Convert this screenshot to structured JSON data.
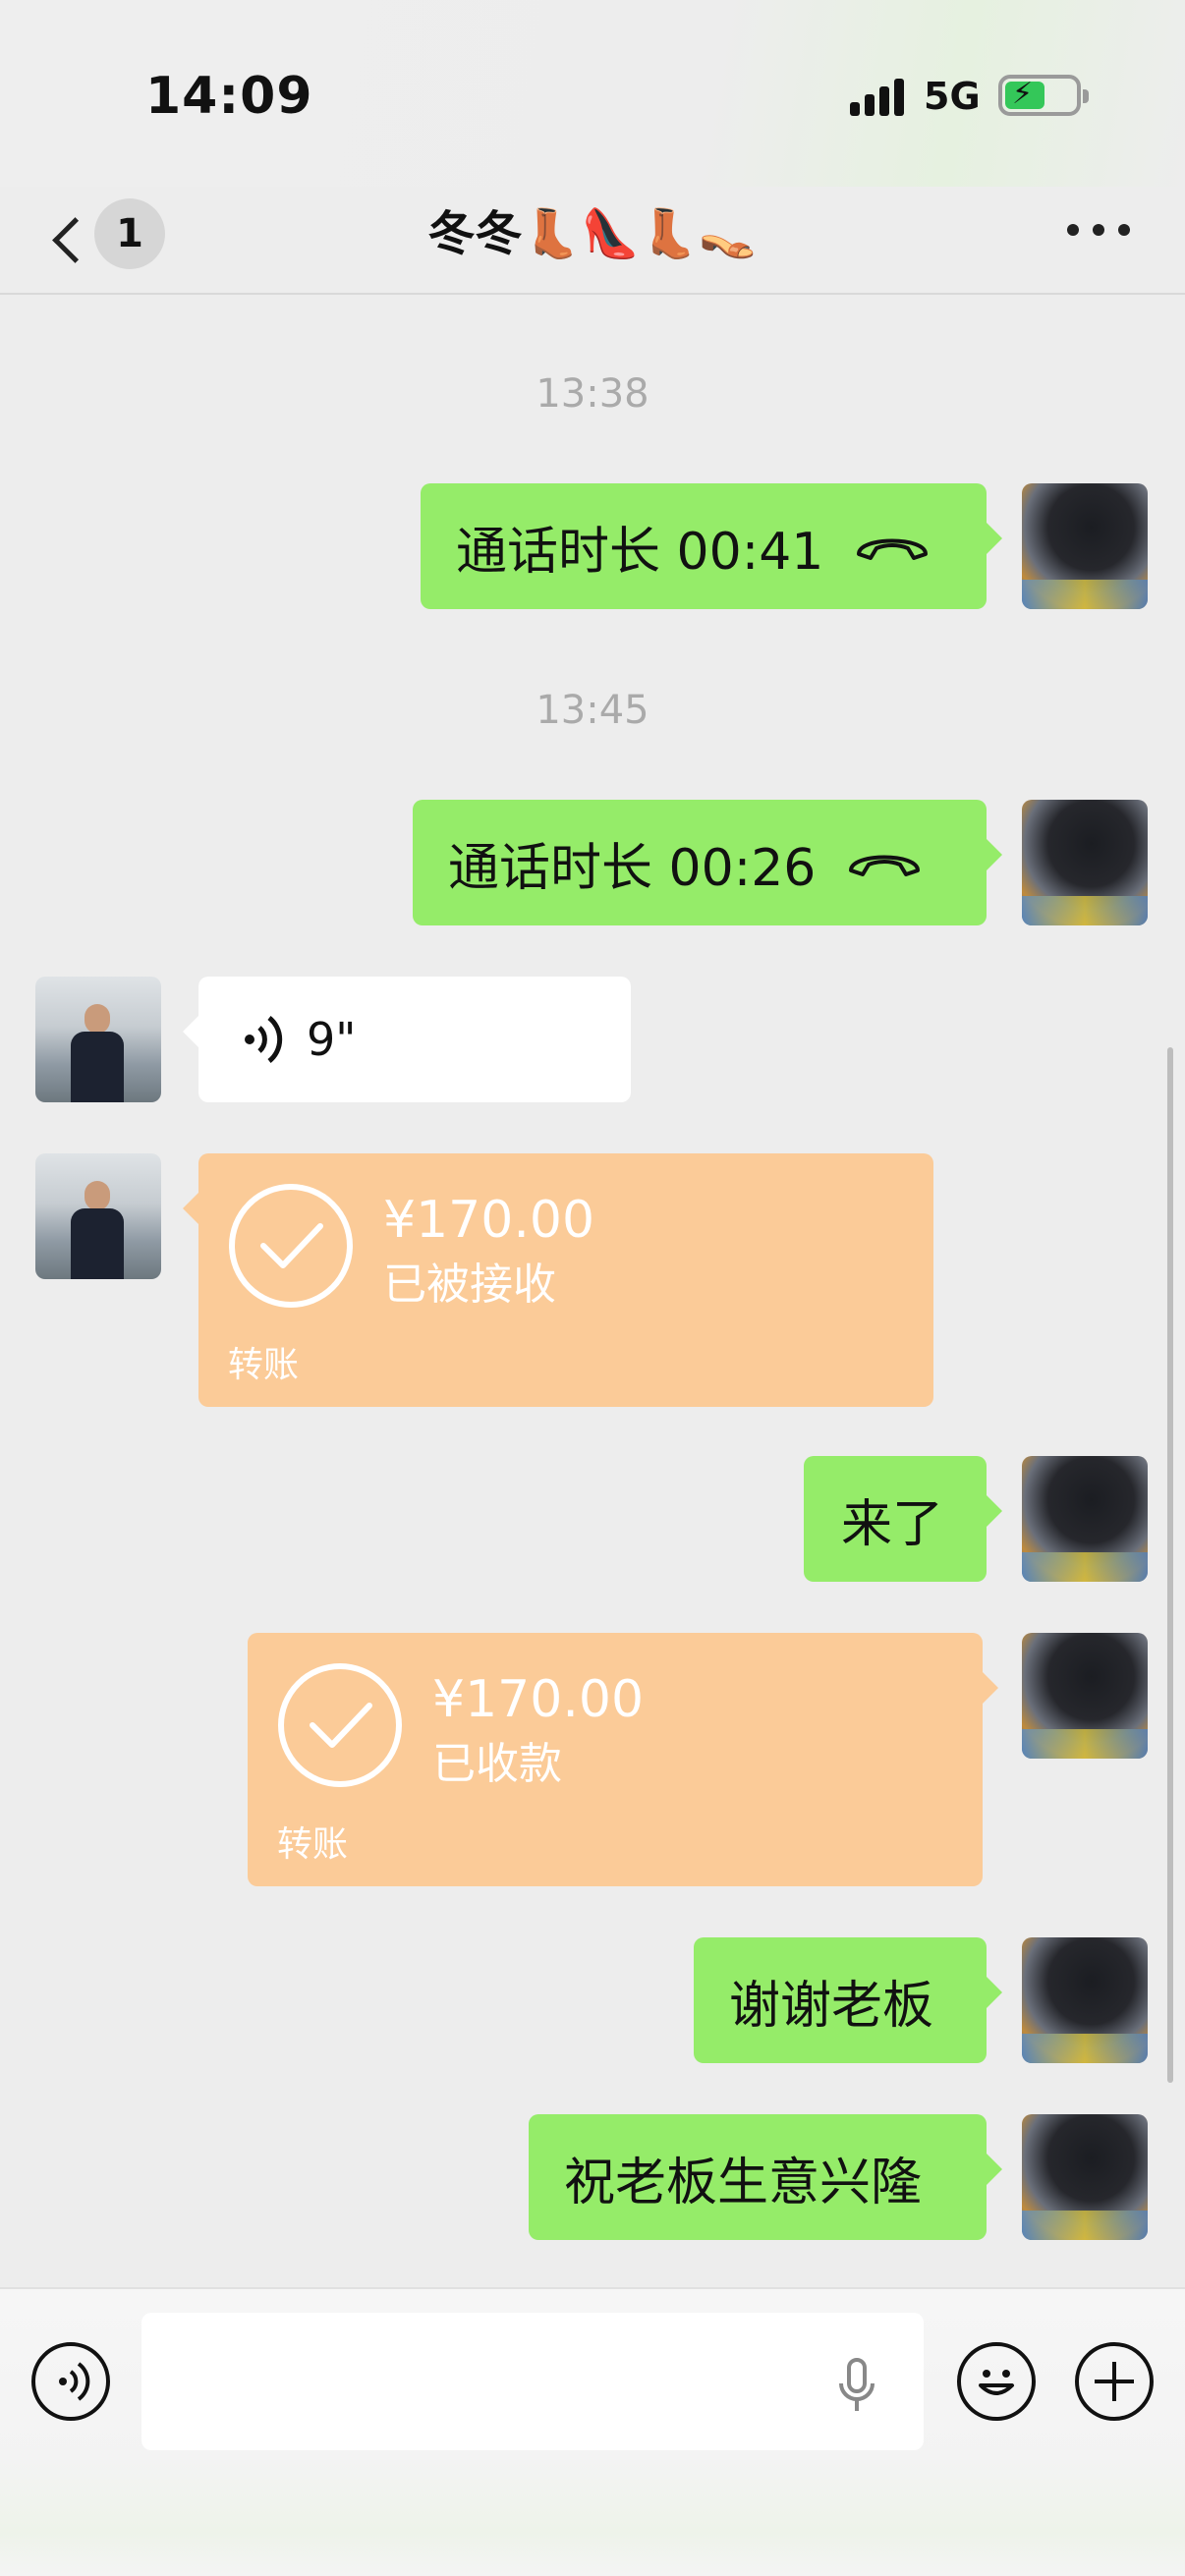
{
  "status_bar": {
    "time": "14:09",
    "network": "5G",
    "battery_charging": true
  },
  "nav": {
    "unread_count": "1",
    "title": "冬冬👢👠👢👡"
  },
  "messages": [
    {
      "type": "timestamp",
      "text": "13:38"
    },
    {
      "type": "call",
      "from": "me",
      "text": "通话时长 00:41"
    },
    {
      "type": "timestamp",
      "text": "13:45"
    },
    {
      "type": "call",
      "from": "me",
      "text": "通话时长 00:26"
    },
    {
      "type": "voice",
      "from": "other",
      "duration": "9\""
    },
    {
      "type": "transfer",
      "from": "other",
      "amount": "¥170.00",
      "status": "已被接收",
      "kind": "转账"
    },
    {
      "type": "text",
      "from": "me",
      "text": "来了"
    },
    {
      "type": "transfer",
      "from": "me",
      "amount": "¥170.00",
      "status": "已收款",
      "kind": "转账"
    },
    {
      "type": "text",
      "from": "me",
      "text": "谢谢老板"
    },
    {
      "type": "text",
      "from": "me",
      "text": "祝老板生意兴隆"
    }
  ],
  "colors": {
    "bubble_me": "#95ec69",
    "bubble_other": "#ffffff",
    "transfer": "#fbcb98",
    "background": "#ededed"
  },
  "icons": [
    "back-icon",
    "more-icon",
    "call-end-icon",
    "voice-wave-icon",
    "check-circle-icon",
    "voice-input-icon",
    "mic-icon",
    "emoji-icon",
    "plus-icon"
  ]
}
